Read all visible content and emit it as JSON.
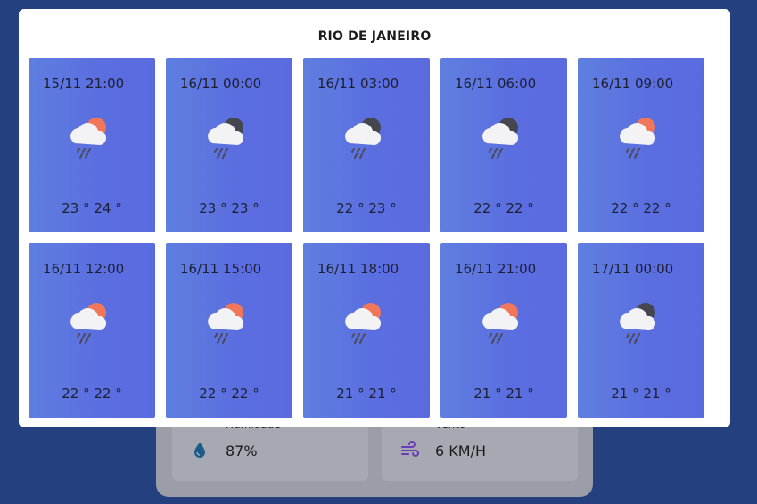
{
  "modal": {
    "title": "RIO DE JANEIRO"
  },
  "forecast": [
    {
      "time": "15/11 21:00",
      "temp": "23 ° 24 °",
      "icon": "rain-sun-icon"
    },
    {
      "time": "16/11 00:00",
      "temp": "23 ° 23 °",
      "icon": "rain-moon-icon"
    },
    {
      "time": "16/11 03:00",
      "temp": "22 ° 23 °",
      "icon": "rain-moon-icon"
    },
    {
      "time": "16/11 06:00",
      "temp": "22 ° 22 °",
      "icon": "rain-moon-icon"
    },
    {
      "time": "16/11 09:00",
      "temp": "22 ° 22 °",
      "icon": "rain-sun-icon"
    },
    {
      "time": "16/11 12:00",
      "temp": "22 ° 22 °",
      "icon": "rain-sun-icon"
    },
    {
      "time": "16/11 15:00",
      "temp": "22 ° 22 °",
      "icon": "rain-sun-icon"
    },
    {
      "time": "16/11 18:00",
      "temp": "21 ° 21 °",
      "icon": "rain-sun-icon"
    },
    {
      "time": "16/11 21:00",
      "temp": "21 ° 21 °",
      "icon": "rain-sun-icon"
    },
    {
      "time": "17/11 00:00",
      "temp": "21 ° 21 °",
      "icon": "rain-moon-icon"
    }
  ],
  "background": {
    "humidity_label": "Humidade",
    "humidity_value": "87%",
    "wind_label": "Vento",
    "wind_value": "6 KM/H"
  },
  "colors": {
    "page_bg": "#24407e",
    "card_gradient_start": "#5f7fe0",
    "card_gradient_end": "#5a6be0",
    "sun": "#f0775a",
    "moon": "#454650",
    "rain": "#4a4a5a"
  }
}
